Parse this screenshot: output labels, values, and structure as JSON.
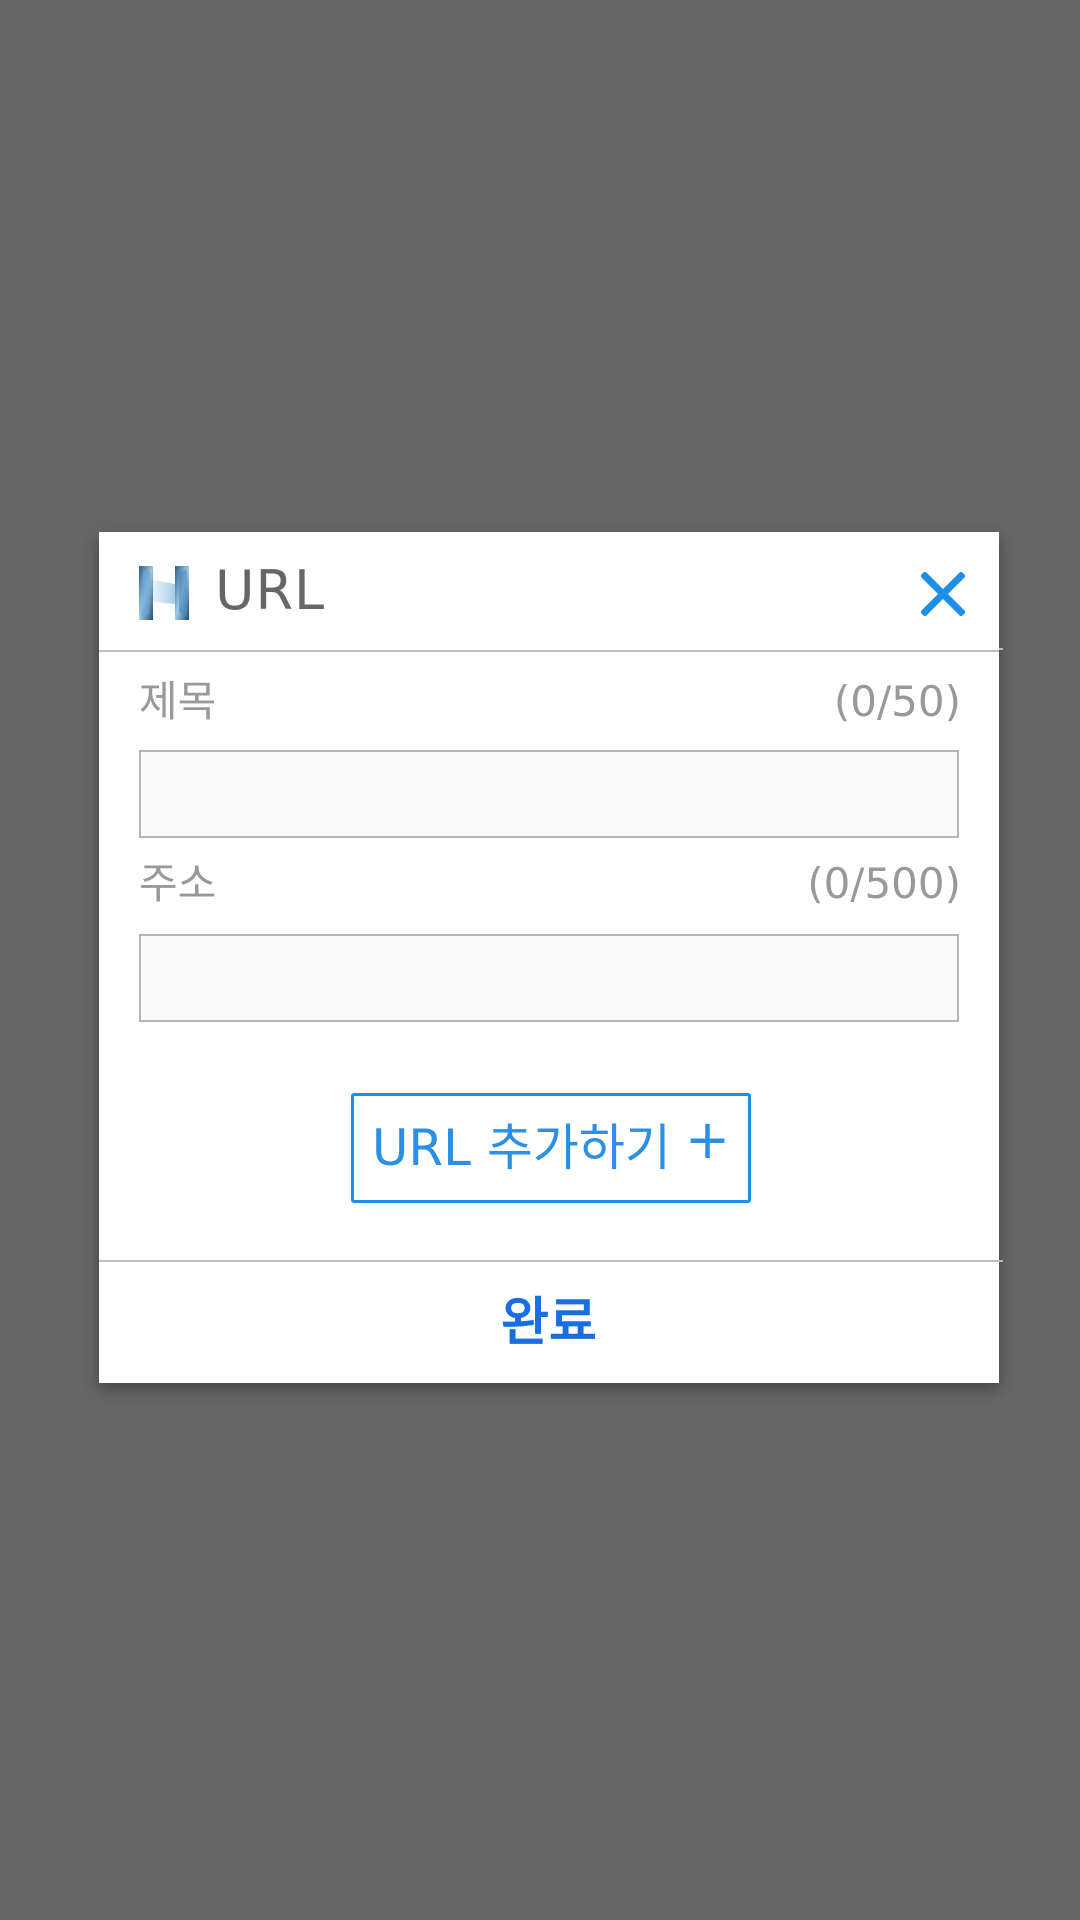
{
  "dialog": {
    "title": "URL",
    "close_icon": "close-icon",
    "logo_icon": "app-logo-h-icon",
    "accent_color": "#1e8fe6"
  },
  "fields": {
    "title_field": {
      "label": "제목",
      "count": "(0/50)",
      "value": "",
      "placeholder": ""
    },
    "address_field": {
      "label": "주소",
      "count": "(0/500)",
      "value": "",
      "placeholder": ""
    }
  },
  "actions": {
    "add_url_label": "URL 추가하기",
    "add_url_icon": "plus-icon",
    "add_url_symbol": "+",
    "done_label": "완료"
  }
}
